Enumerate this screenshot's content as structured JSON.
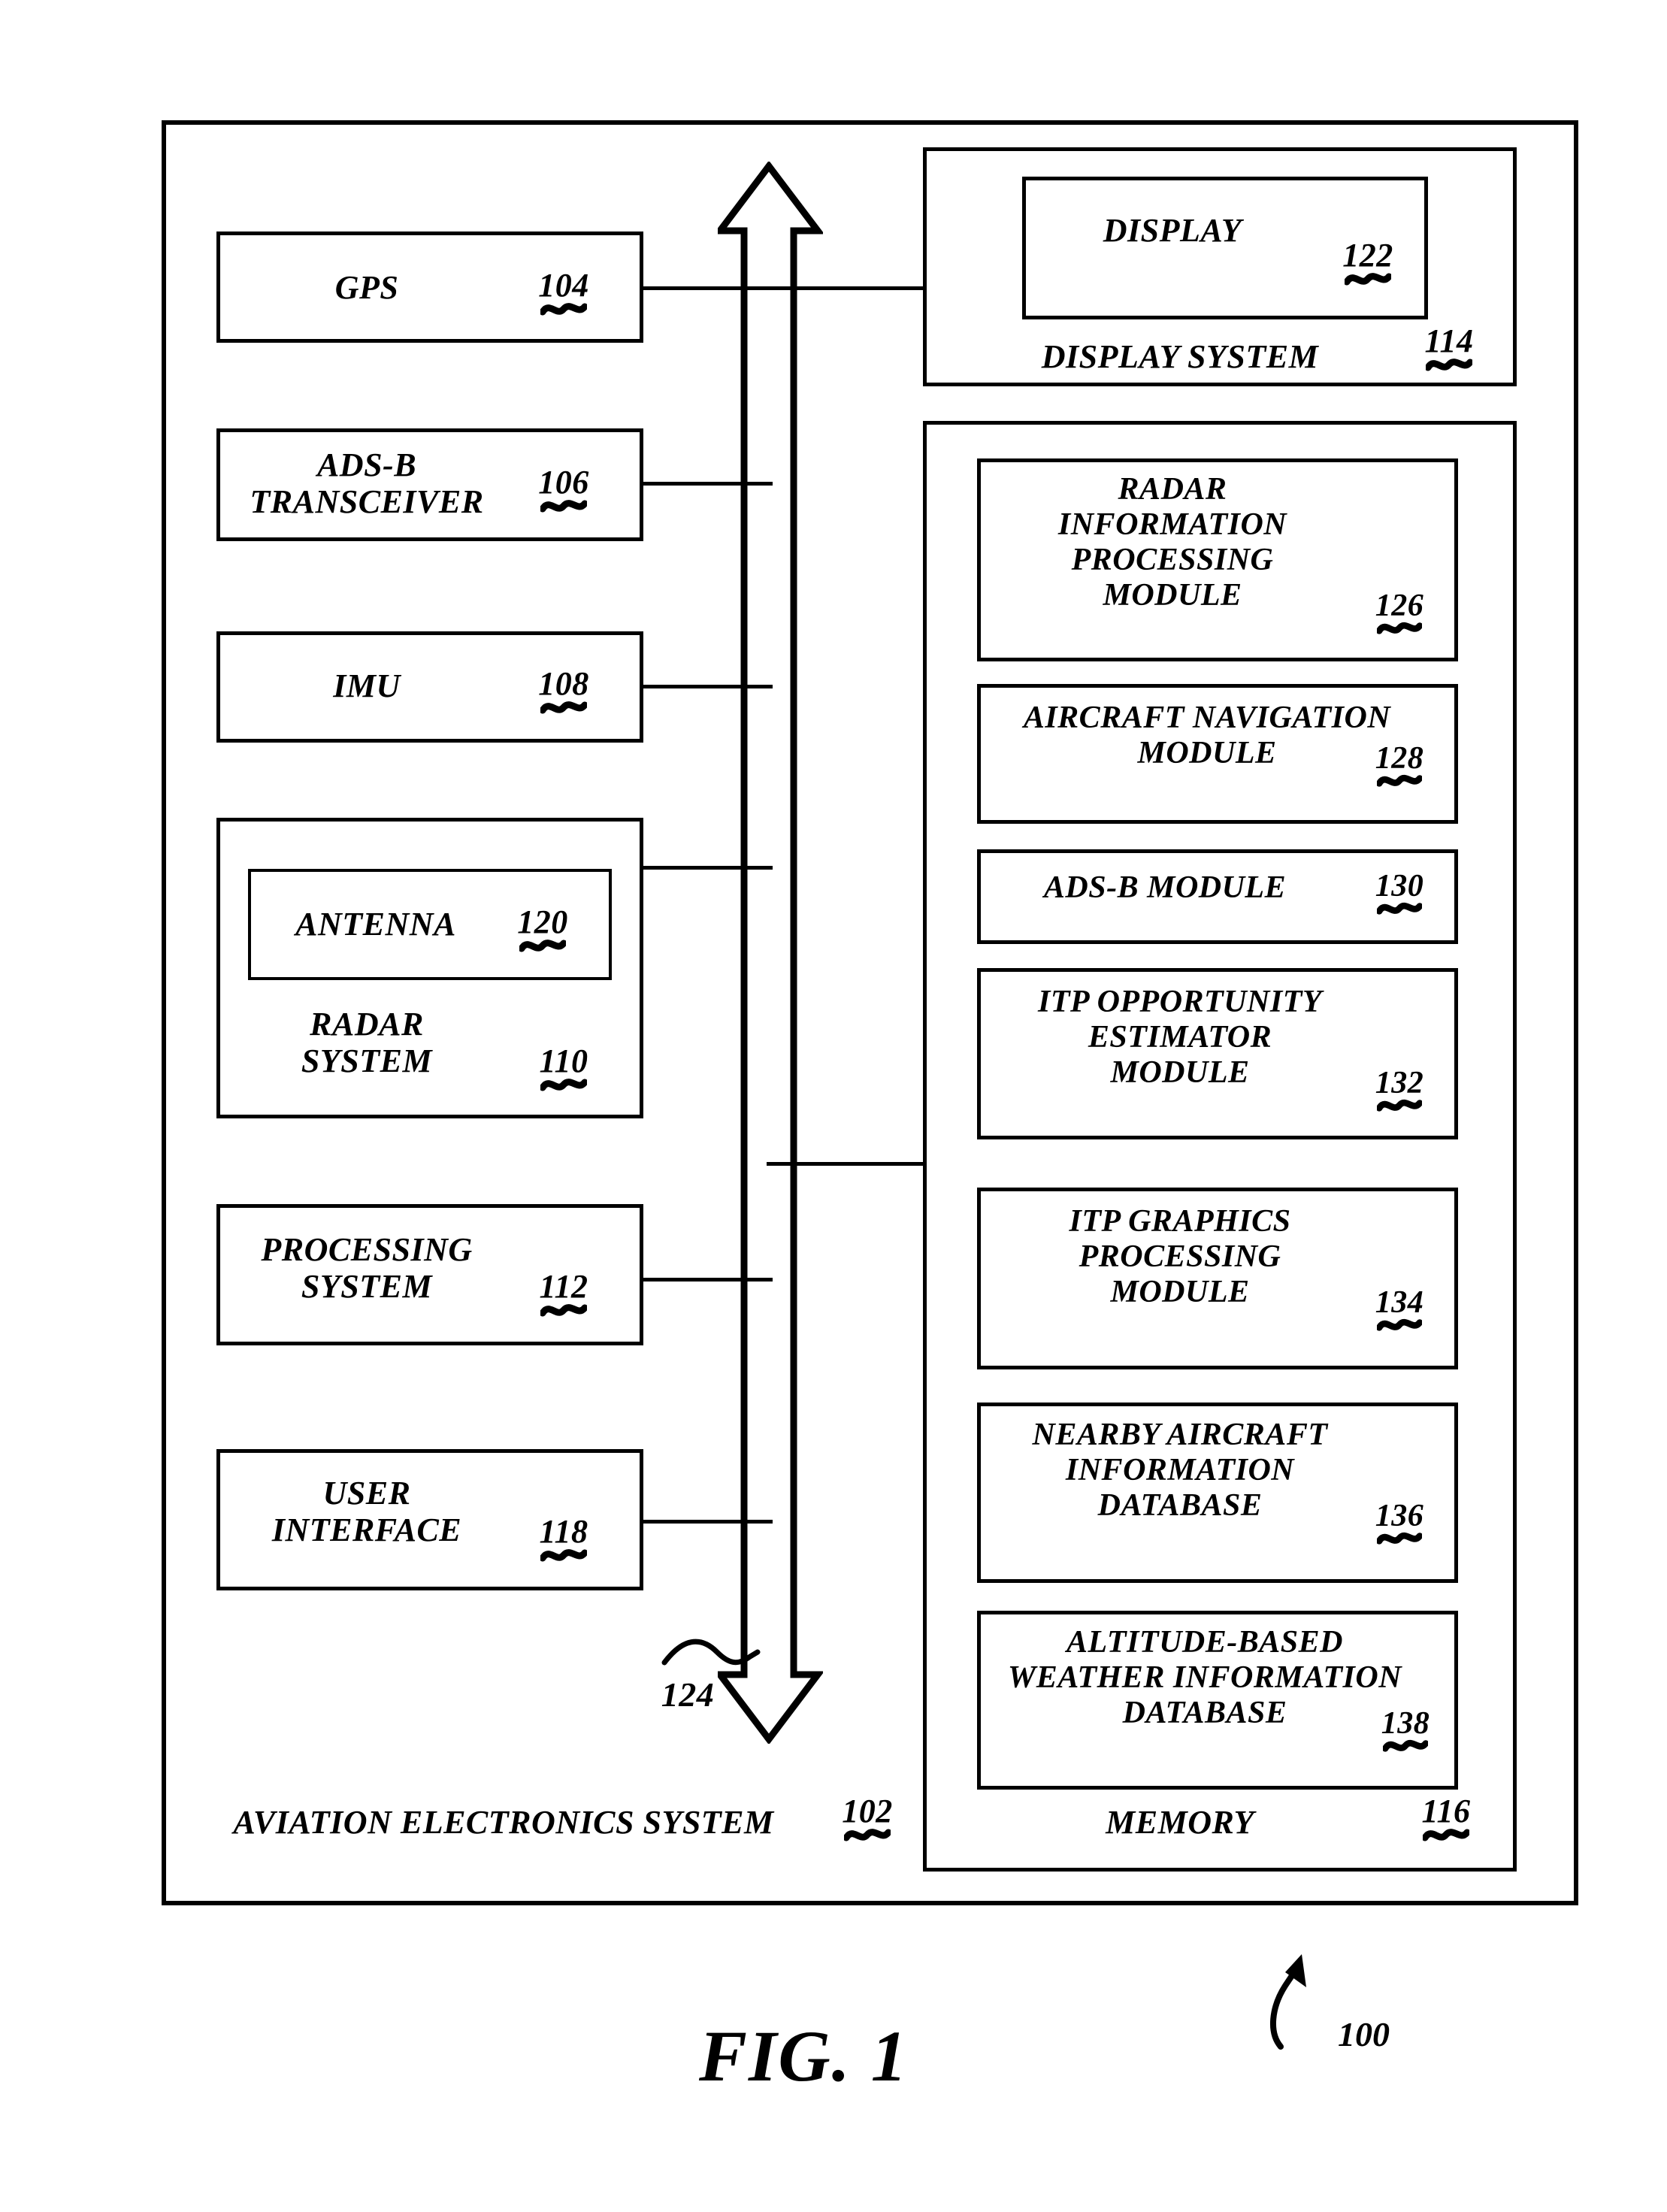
{
  "figure": {
    "caption": "FIG. 1",
    "overall_ref": "100"
  },
  "outer_system": {
    "label": "AVIATION ELECTRONICS SYSTEM",
    "ref": "102"
  },
  "bus": {
    "ref": "124",
    "name": "data-bus-arrow"
  },
  "left_column": [
    {
      "label": "GPS",
      "ref": "104"
    },
    {
      "label": "ADS-B\nTRANSCEIVER",
      "ref": "106"
    },
    {
      "label": "IMU",
      "ref": "108"
    },
    {
      "label": "RADAR\nSYSTEM",
      "ref": "110",
      "child": {
        "label": "ANTENNA",
        "ref": "120"
      }
    },
    {
      "label": "PROCESSING\nSYSTEM",
      "ref": "112"
    },
    {
      "label": "USER\nINTERFACE",
      "ref": "118"
    }
  ],
  "display_system": {
    "label": "DISPLAY SYSTEM",
    "ref": "114",
    "child": {
      "label": "DISPLAY",
      "ref": "122"
    }
  },
  "memory": {
    "label": "MEMORY",
    "ref": "116",
    "modules": [
      {
        "label": "RADAR\nINFORMATION\nPROCESSING\nMODULE",
        "ref": "126"
      },
      {
        "label": "AIRCRAFT NAVIGATION\nMODULE",
        "ref": "128"
      },
      {
        "label": "ADS-B MODULE",
        "ref": "130"
      },
      {
        "label": "ITP OPPORTUNITY\nESTIMATOR\nMODULE",
        "ref": "132"
      },
      {
        "label": "ITP GRAPHICS\nPROCESSING\nMODULE",
        "ref": "134"
      },
      {
        "label": "NEARBY AIRCRAFT\nINFORMATION\nDATABASE",
        "ref": "136"
      },
      {
        "label": "ALTITUDE-BASED\nWEATHER INFORMATION\nDATABASE",
        "ref": "138"
      }
    ]
  },
  "colors": {
    "ink": "#000000",
    "paper": "#ffffff"
  }
}
